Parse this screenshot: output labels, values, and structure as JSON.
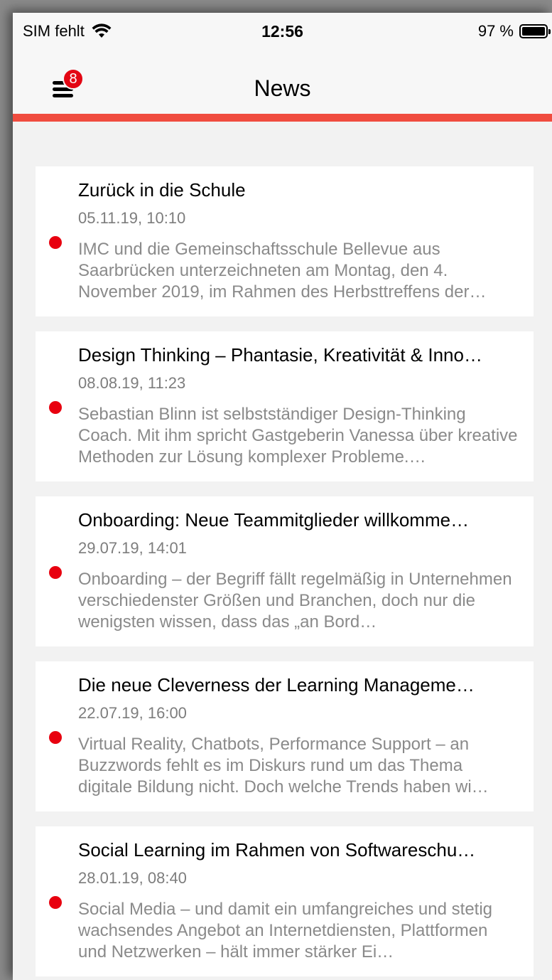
{
  "status_bar": {
    "carrier": "SIM fehlt",
    "time": "12:56",
    "battery": "97 %"
  },
  "nav": {
    "title": "News",
    "badge_count": "8",
    "accent_color": "#f04c3f"
  },
  "news": [
    {
      "title": "Zurück in die Schule",
      "date": "05.11.19, 10:10",
      "excerpt": "IMC und die Gemeinschaftsschule Bellevue aus Saarbrücken unterzeichneten am Montag, den 4. November 2019, im Rahmen des Herbsttreffens der…"
    },
    {
      "title": "Design Thinking – Phantasie, Kreativität & Inno…",
      "date": "08.08.19, 11:23",
      "excerpt": "Sebastian Blinn ist selbstständiger Design-Thinking Coach. Mit ihm spricht Gastgeberin Vanessa über kreative Methoden zur Lösung komplexer Probleme.…"
    },
    {
      "title": "Onboarding: Neue Teammitglieder willkomme…",
      "date": "29.07.19, 14:01",
      "excerpt": "Onboarding – der Begriff fällt regelmäßig in Unternehmen verschiedenster Größen und Branchen, doch nur die wenigsten wissen, dass das „an Bord…"
    },
    {
      "title": "Die neue Cleverness der Learning Manageme…",
      "date": "22.07.19, 16:00",
      "excerpt": "Virtual Reality, Chatbots, Performance Support – an Buzzwords fehlt es im Diskurs rund um das Thema digitale Bildung nicht. Doch welche Trends haben wi…"
    },
    {
      "title": "Social Learning im Rahmen von Softwareschu…",
      "date": "28.01.19, 08:40",
      "excerpt": "Social Media – und damit ein umfangreiches und stetig wachsendes Angebot an Internetdiensten, Plattformen und Netzwerken – hält immer stärker Ei…"
    }
  ]
}
